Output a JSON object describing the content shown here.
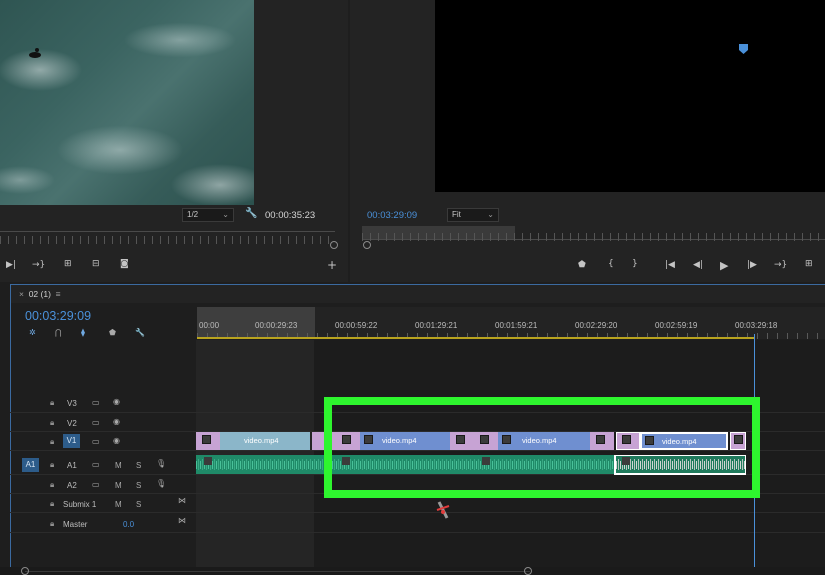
{
  "source": {
    "resolution": "1/2",
    "timecode": "00:00:35:23"
  },
  "program": {
    "timecode": "00:03:29:09",
    "zoom": "Fit"
  },
  "timeline": {
    "sequence_tab": "02 (1)",
    "timecode": "00:03:29:09",
    "ruler_labels": [
      "00:00",
      "00:00:29:23",
      "00:00:59:22",
      "00:01:29:21",
      "00:01:59:21",
      "00:02:29:20",
      "00:02:59:19",
      "00:03:29:18"
    ],
    "tracks": {
      "v3": "V3",
      "v2": "V2",
      "v1": "V1",
      "a1_src": "A1",
      "a1": "A1",
      "a2": "A2",
      "submix": "Submix 1",
      "master": "Master",
      "master_value": "0.0",
      "m": "M",
      "s": "S"
    },
    "clips": [
      "video.mp4",
      "video.mp4",
      "video.mp4",
      "video.mp4"
    ]
  },
  "colors": {
    "accent": "#4a90d9",
    "highlight": "#2ef52e",
    "video_clip": "#6f8fd0",
    "audio_clip": "#1f8a68"
  }
}
